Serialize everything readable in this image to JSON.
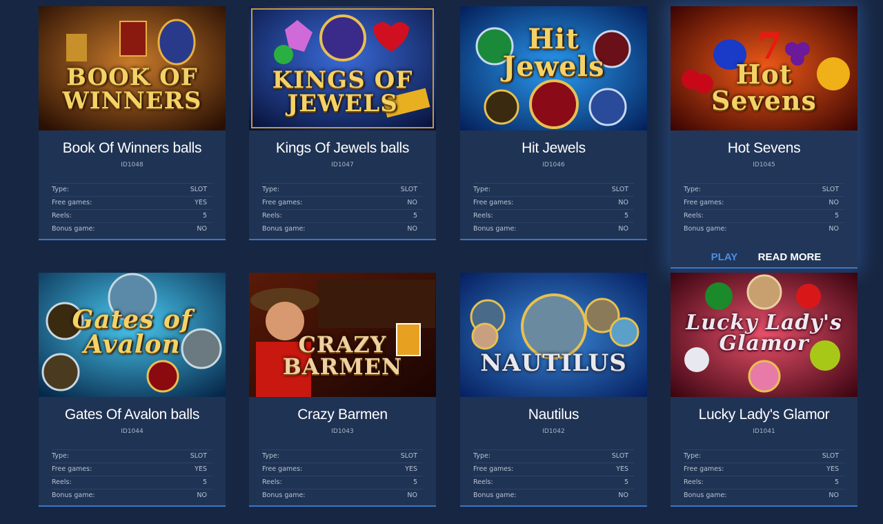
{
  "labels": {
    "type": "Type:",
    "free_games": "Free games:",
    "reels": "Reels:",
    "bonus_game": "Bonus game:"
  },
  "actions": {
    "play": "PLAY",
    "read_more": "READ MORE"
  },
  "games": [
    {
      "title": "Book Of Winners balls",
      "id": "ID1048",
      "type": "SLOT",
      "free_games": "YES",
      "reels": "5",
      "bonus_game": "NO",
      "logo": "BOOK OF WINNERS",
      "bg": [
        "#3a1a05",
        "#a0561a"
      ]
    },
    {
      "title": "Kings Of Jewels balls",
      "id": "ID1047",
      "type": "SLOT",
      "free_games": "NO",
      "reels": "5",
      "bonus_game": "NO",
      "logo": "KINGS OF JEWELS",
      "bg": [
        "#0a1850",
        "#2a4ab0"
      ]
    },
    {
      "title": "Hit Jewels",
      "id": "ID1046",
      "type": "SLOT",
      "free_games": "NO",
      "reels": "5",
      "bonus_game": "NO",
      "logo": "Hit Jewels",
      "bg": [
        "#062a70",
        "#1e7ad8"
      ]
    },
    {
      "title": "Hot Sevens",
      "id": "ID1045",
      "type": "SLOT",
      "free_games": "NO",
      "reels": "5",
      "bonus_game": "NO",
      "logo": "Hot Sevens",
      "bg": [
        "#5a0a04",
        "#d83a10"
      ]
    },
    {
      "title": "Gates Of Avalon balls",
      "id": "ID1044",
      "type": "SLOT",
      "free_games": "YES",
      "reels": "5",
      "bonus_game": "NO",
      "logo": "Gates of Avalon",
      "bg": [
        "#0a3a6a",
        "#3ab0e0"
      ]
    },
    {
      "title": "Crazy Barmen",
      "id": "ID1043",
      "type": "SLOT",
      "free_games": "YES",
      "reels": "5",
      "bonus_game": "NO",
      "logo": "CRAZY BARMEN",
      "bg": [
        "#2a0a04",
        "#8a2a10"
      ]
    },
    {
      "title": "Nautilus",
      "id": "ID1042",
      "type": "SLOT",
      "free_games": "YES",
      "reels": "5",
      "bonus_game": "NO",
      "logo": "NAUTILUS",
      "bg": [
        "#08306a",
        "#2a70c0"
      ]
    },
    {
      "title": "Lucky Lady's Glamor",
      "id": "ID1041",
      "type": "SLOT",
      "free_games": "YES",
      "reels": "5",
      "bonus_game": "NO",
      "logo": "Lucky Lady's Glamor",
      "bg": [
        "#5a0618",
        "#d83050"
      ]
    }
  ]
}
